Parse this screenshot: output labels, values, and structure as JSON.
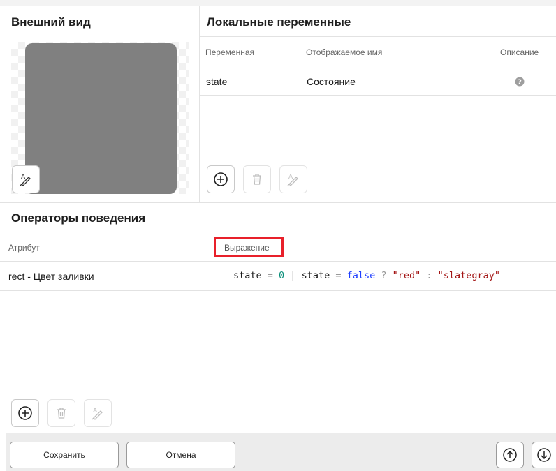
{
  "appearance": {
    "title": "Внешний вид"
  },
  "local_vars": {
    "title": "Локальные переменные",
    "columns": {
      "variable": "Переменная",
      "display_name": "Отображаемое имя",
      "description": "Описание"
    },
    "rows": [
      {
        "variable": "state",
        "display_name": "Состояние",
        "description_icon": "help-icon"
      }
    ]
  },
  "behavior": {
    "title": "Операторы поведения",
    "columns": {
      "attribute": "Атрибут",
      "expression": "Выражение"
    },
    "rows": [
      {
        "attribute": "rect - Цвет заливки",
        "expression_tokens": [
          "state",
          " = ",
          "0",
          " | ",
          "state",
          " = ",
          "false",
          " ? ",
          "\"red\"",
          " : ",
          "\"slategray\""
        ]
      }
    ]
  },
  "footer": {
    "save_label": "Сохранить",
    "cancel_label": "Отмена"
  },
  "icons": {
    "add": "plus-circle-icon",
    "delete": "trash-icon",
    "edit": "text-edit-icon",
    "up": "arrow-up-circle-icon",
    "down": "arrow-down-circle-icon"
  },
  "colors": {
    "highlight": "#e8202a",
    "preview_fill": "#808080"
  }
}
